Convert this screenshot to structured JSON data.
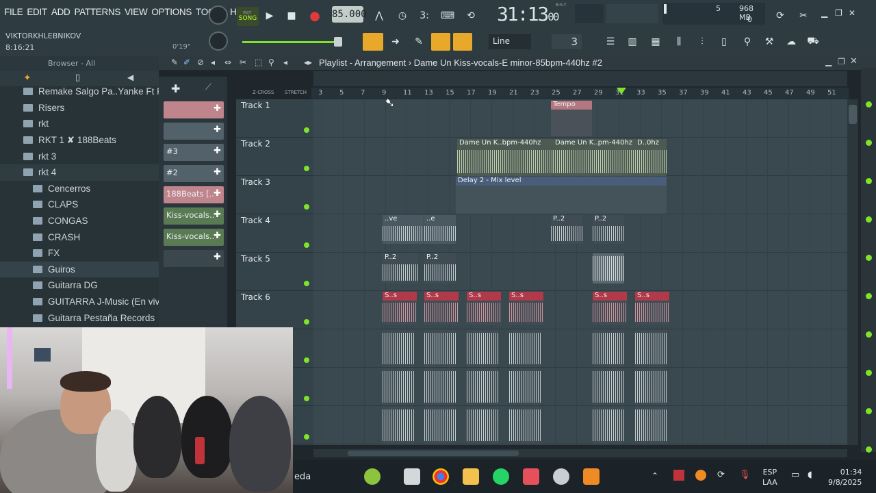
{
  "menu": [
    "FILE",
    "EDIT",
    "ADD",
    "PATTERNS",
    "VIEW",
    "OPTIONS",
    "TOOLS",
    "HELP"
  ],
  "user": "VIKTORKHLEBNIKOV",
  "clock_small": "8:16:21",
  "time_small": "0'19\"",
  "transport": {
    "mode": "SONG",
    "mode_small": "PAT",
    "tempo": "85.000",
    "song_time_main": "31:13",
    "song_time_sub": "00",
    "bst_label": "B:S:T"
  },
  "cpu": {
    "voices": "5",
    "memory": "968 MB",
    "cpu": "0"
  },
  "snap": {
    "mode": "Line",
    "value": "3"
  },
  "browser": {
    "title": "Browser - All",
    "items": [
      {
        "label": "Remake Salgo Pa..Yanke Ft Randy",
        "level": 1
      },
      {
        "label": "Risers",
        "level": 1
      },
      {
        "label": "rkt",
        "level": 1
      },
      {
        "label": "RKT 1  ✘ 188Beats",
        "level": 1
      },
      {
        "label": "rkt 3",
        "level": 1
      },
      {
        "label": "rkt 4",
        "level": 1
      },
      {
        "label": "Cencerros",
        "level": 2
      },
      {
        "label": "CLAPS",
        "level": 2
      },
      {
        "label": "CONGAS",
        "level": 2
      },
      {
        "label": "CRASH",
        "level": 2
      },
      {
        "label": "FX",
        "level": 2
      },
      {
        "label": "Guiros",
        "level": 2
      },
      {
        "label": "Guitarra DG",
        "level": 2
      },
      {
        "label": "GUITARRA J-Music (En vivo)",
        "level": 2
      },
      {
        "label": "Guitarra Pestaña Records",
        "level": 2
      }
    ]
  },
  "channels": [
    {
      "label": "",
      "color": "#c0858c"
    },
    {
      "label": "",
      "color": "#52616a"
    },
    {
      "label": "#3",
      "color": "#52616a"
    },
    {
      "label": "#2",
      "color": "#52616a"
    },
    {
      "label": "188Beats [..",
      "color": "#c0858c"
    },
    {
      "label": "Kiss-vocals..",
      "color": "#5a7a54"
    },
    {
      "label": "Kiss-vocals..",
      "color": "#5a7a54"
    },
    {
      "label": "",
      "color": "#3a474d"
    }
  ],
  "playlist": {
    "title": "Playlist - Arrangement",
    "pattern": "Dame Un Kiss-vocals-E minor-85bpm-440hz #2",
    "zcross": "Z-CROSS",
    "stretch": "STRETCH",
    "ruler": [
      "3",
      "5",
      "7",
      "9",
      "11",
      "13",
      "15",
      "17",
      "19",
      "21",
      "23",
      "25",
      "27",
      "29",
      "31",
      "33",
      "35",
      "37",
      "39",
      "41",
      "43",
      "45",
      "47",
      "49",
      "51"
    ],
    "tracks": [
      "Track 1",
      "Track 2",
      "Track 3",
      "Track 4",
      "Track 5",
      "Track 6",
      "",
      "",
      ""
    ],
    "clips": {
      "tempo": "Tempo",
      "vocal_a": "Dame Un K..bpm-440hz",
      "vocal_b": "Dame Un K..pm-440hz",
      "vocal_c": "D..0hz",
      "delay": "Delay 2 - Mix level",
      "t4_a": "..ve",
      "t4_b": "..e",
      "t4_c": "P..2",
      "t4_d": "P..2",
      "t5_a": "P..2",
      "t5_b": "P..2",
      "t6": "S..s"
    }
  },
  "taskbar": {
    "search": "eda",
    "lang1": "ESP",
    "lang2": "LAA",
    "time": "01:34",
    "date": "9/8/2025"
  }
}
